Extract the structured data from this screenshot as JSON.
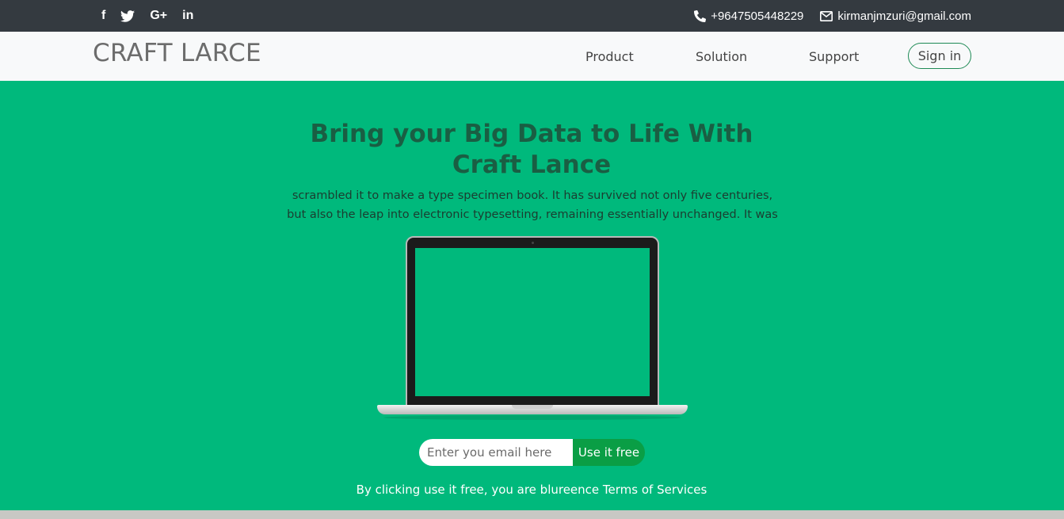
{
  "topbar": {
    "social": [
      {
        "name": "facebook-icon",
        "glyph": "f"
      },
      {
        "name": "twitter-icon",
        "glyph": ""
      },
      {
        "name": "google-plus-icon",
        "glyph": "G+"
      },
      {
        "name": "linkedin-icon",
        "glyph": "in"
      }
    ],
    "phone": "+9647505448229",
    "email": "kirmanjmzuri@gmail.com"
  },
  "navbar": {
    "brand": "CRAFT LARCE",
    "links": [
      "Product",
      "Solution",
      "Support"
    ],
    "signin": "Sign in"
  },
  "hero": {
    "title": "Bring your Big Data to Life With Craft Lance",
    "text": "scrambled it to make a type specimen book. It has survived not only five centuries, but also the leap into electronic typesetting, remaining essentially unchanged. It was",
    "email_placeholder": "Enter you email here",
    "cta": "Use it free",
    "terms": "By clicking use it free, you are blureence Terms of Services"
  },
  "colors": {
    "topbar": "#343a40",
    "navbar": "#f8f9fa",
    "hero": "#00b97c",
    "cta": "#0a9e45"
  }
}
